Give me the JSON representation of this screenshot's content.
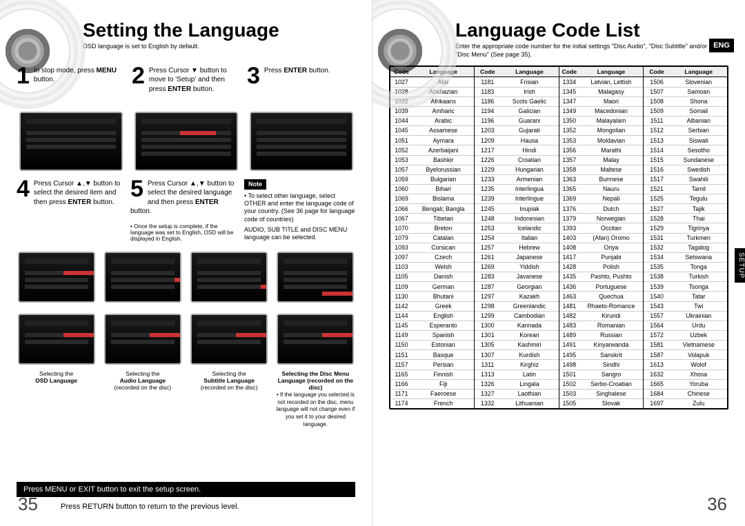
{
  "left": {
    "title": "Setting the Language",
    "subtitle": "OSD language is set to English by default.",
    "page_num": "35",
    "steps": {
      "s1": {
        "n": "1",
        "text_a": "In stop mode, press ",
        "text_b": "MENU",
        "text_c": " button."
      },
      "s2": {
        "n": "2",
        "text_a": "Press Cursor ▼ button to move to 'Setup' and then press ",
        "text_b": "ENTER",
        "text_c": " button."
      },
      "s3": {
        "n": "3",
        "text_a": "Press ",
        "text_b": "ENTER",
        "text_c": " button."
      },
      "s4": {
        "n": "4",
        "text_a": "Press Cursor ▲,▼ button to select the desired item and then press ",
        "text_b": "ENTER",
        "text_c": " button."
      },
      "s5": {
        "n": "5",
        "text_a": "Press Cursor ▲,▼ button to select the desired language and then press ",
        "text_b": "ENTER",
        "text_c": " button."
      }
    },
    "setup_done_note": "• Once the setup is complete, if the language was set to English, OSD will be displayed in English.",
    "note_label": "Note",
    "note_items": {
      "n1": "• To select other language, select OTHER and enter the language code of your country. (See 36 page for language code of countries)",
      "n2": "AUDIO, SUB TITLE and DISC MENU language can be selected."
    },
    "captions": {
      "c1": {
        "a": "Selecting the",
        "b": "OSD Language"
      },
      "c2": {
        "a": "Selecting the",
        "b": "Audio Language",
        "c": "(recorded on the disc)"
      },
      "c3": {
        "a": "Selecting the",
        "b": "Subtitle Language",
        "c": "(recorded on the disc)"
      },
      "c4": {
        "a": "Selecting the Disc Menu",
        "b": "Language (recorded on the disc)"
      }
    },
    "disc_menu_note": "• If the language you selected is not recorded on the disc, menu language will not change even if you set it to your desired language.",
    "foot_bar": "Press MENU or  EXIT button to exit the setup screen.",
    "foot_note": "Press RETURN button to return to the previous level."
  },
  "right": {
    "title": "Language Code List",
    "subtitle": "Enter the appropriate code number for the initial settings \"Disc Audio\", \"Disc Subtitle\" and/or \"Disc Menu\" (See page 35).",
    "lang_badge": "ENG",
    "setup_tab": "SETUP",
    "page_num": "36",
    "headers": {
      "code": "Code",
      "lang": "Language"
    },
    "columns": [
      [
        [
          "1027",
          "Afar"
        ],
        [
          "1028",
          "Abkhazian"
        ],
        [
          "1032",
          "Afrikaans"
        ],
        [
          "1039",
          "Amharic"
        ],
        [
          "1044",
          "Arabic"
        ],
        [
          "1045",
          "Assamese"
        ],
        [
          "1051",
          "Aymara"
        ],
        [
          "1052",
          "Azerbaijani"
        ],
        [
          "1053",
          "Bashkir"
        ],
        [
          "1057",
          "Byelorussian"
        ],
        [
          "1059",
          "Bulgarian"
        ],
        [
          "1060",
          "Bihari"
        ],
        [
          "1069",
          "Bislama"
        ],
        [
          "1066",
          "Bengali; Bangla"
        ],
        [
          "1067",
          "Tibetan"
        ],
        [
          "1070",
          "Breton"
        ],
        [
          "1079",
          "Catalan"
        ],
        [
          "1093",
          "Corsican"
        ],
        [
          "1097",
          "Czech"
        ],
        [
          "1103",
          "Welsh"
        ],
        [
          "1105",
          "Danish"
        ],
        [
          "1109",
          "German"
        ],
        [
          "1130",
          "Bhutani"
        ],
        [
          "1142",
          "Greek"
        ],
        [
          "1144",
          "English"
        ],
        [
          "1145",
          "Esperanto"
        ],
        [
          "1149",
          "Spanish"
        ],
        [
          "1150",
          "Estonian"
        ],
        [
          "1151",
          "Basque"
        ],
        [
          "1157",
          "Persian"
        ],
        [
          "1165",
          "Finnish"
        ],
        [
          "1166",
          "Fiji"
        ],
        [
          "1171",
          "Faeroese"
        ],
        [
          "1174",
          "French"
        ]
      ],
      [
        [
          "1181",
          "Frisian"
        ],
        [
          "1183",
          "Irish"
        ],
        [
          "1186",
          "Scots Gaelic"
        ],
        [
          "1194",
          "Galician"
        ],
        [
          "1196",
          "Guarani"
        ],
        [
          "1203",
          "Gujarati"
        ],
        [
          "1209",
          "Hausa"
        ],
        [
          "1217",
          "Hindi"
        ],
        [
          "1226",
          "Croatian"
        ],
        [
          "1229",
          "Hungarian"
        ],
        [
          "1233",
          "Armenian"
        ],
        [
          "1235",
          "Interlingua"
        ],
        [
          "1239",
          "Interlingue"
        ],
        [
          "1245",
          "Inupiak"
        ],
        [
          "1248",
          "Indonesian"
        ],
        [
          "1253",
          "Icelandic"
        ],
        [
          "1254",
          "Italian"
        ],
        [
          "1257",
          "Hebrew"
        ],
        [
          "1261",
          "Japanese"
        ],
        [
          "1269",
          "Yiddish"
        ],
        [
          "1283",
          "Javanese"
        ],
        [
          "1287",
          "Georgian"
        ],
        [
          "1297",
          "Kazakh"
        ],
        [
          "1298",
          "Greenlandic"
        ],
        [
          "1299",
          "Cambodian"
        ],
        [
          "1300",
          "Kannada"
        ],
        [
          "1301",
          "Korean"
        ],
        [
          "1305",
          "Kashmiri"
        ],
        [
          "1307",
          "Kurdish"
        ],
        [
          "1311",
          "Kirghiz"
        ],
        [
          "1313",
          "Latin"
        ],
        [
          "1326",
          "Lingala"
        ],
        [
          "1327",
          "Laothian"
        ],
        [
          "1332",
          "Lithuanian"
        ]
      ],
      [
        [
          "1334",
          "Latvian, Lettish"
        ],
        [
          "1345",
          "Malagasy"
        ],
        [
          "1347",
          "Maori"
        ],
        [
          "1349",
          "Macedonian"
        ],
        [
          "1350",
          "Malayalam"
        ],
        [
          "1352",
          "Mongolian"
        ],
        [
          "1353",
          "Moldavian"
        ],
        [
          "1356",
          "Marathi"
        ],
        [
          "1357",
          "Malay"
        ],
        [
          "1358",
          "Maltese"
        ],
        [
          "1363",
          "Burmese"
        ],
        [
          "1365",
          "Nauru"
        ],
        [
          "1369",
          "Nepali"
        ],
        [
          "1376",
          "Dutch"
        ],
        [
          "1379",
          "Norwegian"
        ],
        [
          "1393",
          "Occitan"
        ],
        [
          "1403",
          "(Afan) Oromo"
        ],
        [
          "1408",
          "Oriya"
        ],
        [
          "1417",
          "Punjabi"
        ],
        [
          "1428",
          "Polish"
        ],
        [
          "1435",
          "Pashto, Pushto"
        ],
        [
          "1436",
          "Portuguese"
        ],
        [
          "1463",
          "Quechua"
        ],
        [
          "1481",
          "Rhaeto-Romance"
        ],
        [
          "1482",
          "Kirundi"
        ],
        [
          "1483",
          "Romanian"
        ],
        [
          "1489",
          "Russian"
        ],
        [
          "1491",
          "Kinyarwanda"
        ],
        [
          "1495",
          "Sanskrit"
        ],
        [
          "1498",
          "Sindhi"
        ],
        [
          "1501",
          "Sangro"
        ],
        [
          "1502",
          "Serbo-Croatian"
        ],
        [
          "1503",
          "Singhalese"
        ],
        [
          "1505",
          "Slovak"
        ]
      ],
      [
        [
          "1506",
          "Slovenian"
        ],
        [
          "1507",
          "Samoan"
        ],
        [
          "1508",
          "Shona"
        ],
        [
          "1509",
          "Somali"
        ],
        [
          "1511",
          "Albanian"
        ],
        [
          "1512",
          "Serbian"
        ],
        [
          "1513",
          "Siswati"
        ],
        [
          "1514",
          "Sesotho"
        ],
        [
          "1515",
          "Sundanese"
        ],
        [
          "1516",
          "Swedish"
        ],
        [
          "1517",
          "Swahili"
        ],
        [
          "1521",
          "Tamil"
        ],
        [
          "1525",
          "Tegulu"
        ],
        [
          "1527",
          "Tajik"
        ],
        [
          "1528",
          "Thai"
        ],
        [
          "1529",
          "Tigrinya"
        ],
        [
          "1531",
          "Turkmen"
        ],
        [
          "1532",
          "Tagalog"
        ],
        [
          "1534",
          "Setswana"
        ],
        [
          "1535",
          "Tonga"
        ],
        [
          "1538",
          "Turkish"
        ],
        [
          "1539",
          "Tsonga"
        ],
        [
          "1540",
          "Tatar"
        ],
        [
          "1543",
          "Twi"
        ],
        [
          "1557",
          "Ukrainian"
        ],
        [
          "1564",
          "Urdu"
        ],
        [
          "1572",
          "Uzbek"
        ],
        [
          "1581",
          "Vietnamese"
        ],
        [
          "1587",
          "Volapuk"
        ],
        [
          "1613",
          "Wolof"
        ],
        [
          "1632",
          "Xhosa"
        ],
        [
          "1665",
          "Yoruba"
        ],
        [
          "1684",
          "Chinese"
        ],
        [
          "1697",
          "Zulu"
        ]
      ]
    ]
  }
}
